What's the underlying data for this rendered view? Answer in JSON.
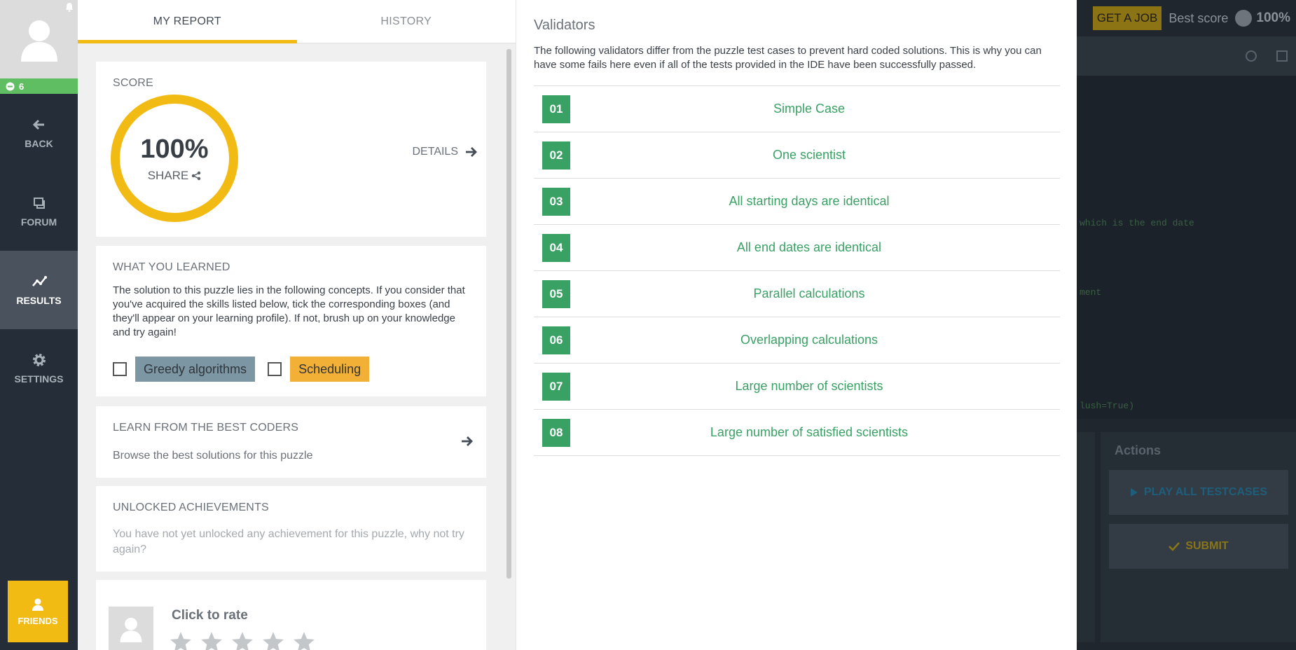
{
  "sidebar": {
    "level": "6",
    "items": [
      {
        "label": "BACK",
        "icon": "arrow-left-icon"
      },
      {
        "label": "FORUM",
        "icon": "forum-icon"
      },
      {
        "label": "RESULTS",
        "icon": "chart-line-icon",
        "active": true
      },
      {
        "label": "SETTINGS",
        "icon": "gear-icon"
      }
    ],
    "friends_label": "FRIENDS"
  },
  "report": {
    "tabs": [
      {
        "label": "MY REPORT",
        "active": true
      },
      {
        "label": "HISTORY",
        "active": false
      }
    ],
    "score": {
      "title": "SCORE",
      "value": "100%",
      "share_label": "SHARE",
      "details_label": "DETAILS"
    },
    "learned": {
      "title": "WHAT YOU LEARNED",
      "text": "The solution to this puzzle lies in the following concepts. If you consider that you've acquired the skills listed below, tick the corresponding boxes (and they'll appear on your learning profile). If not, brush up on your knowledge and try again!",
      "skills": [
        {
          "label": "Greedy algorithms",
          "checked": false,
          "color": "#7d96a3"
        },
        {
          "label": "Scheduling",
          "checked": false,
          "color": "#f3b037"
        }
      ]
    },
    "best_coders": {
      "title": "LEARN FROM THE BEST CODERS",
      "subtitle": "Browse the best solutions for this puzzle"
    },
    "achievements": {
      "title": "UNLOCKED ACHIEVEMENTS",
      "text": "You have not yet unlocked any achievement for this puzzle, why not try again?"
    },
    "rating": {
      "title": "Click to rate",
      "stars": 5,
      "rated": 0
    }
  },
  "validators": {
    "title": "Validators",
    "description": "The following validators differ from the puzzle test cases to prevent hard coded solutions. This is why you can have some fails here even if all of the tests provided in the IDE have been successfully passed.",
    "items": [
      {
        "number": "01",
        "name": "Simple Case"
      },
      {
        "number": "02",
        "name": "One scientist"
      },
      {
        "number": "03",
        "name": "All starting days are identical"
      },
      {
        "number": "04",
        "name": "All end dates are identical"
      },
      {
        "number": "05",
        "name": "Parallel calculations"
      },
      {
        "number": "06",
        "name": "Overlapping calculations"
      },
      {
        "number": "07",
        "name": "Large number of scientists"
      },
      {
        "number": "08",
        "name": "Large number of satisfied scientists"
      }
    ],
    "status_color": "#3aa165"
  },
  "ide": {
    "get_job_label": "GET A JOB",
    "best_score_label": "Best score",
    "best_score_value": "100%",
    "code_fragments": [
      "which is the end date",
      "ment",
      "lush=True)"
    ],
    "actions_title": "Actions",
    "play_all_label": "PLAY ALL TESTCASES",
    "submit_label": "SUBMIT"
  },
  "colors": {
    "accent": "#f2bb13",
    "success": "#3aa165",
    "sidebar_bg": "#252e38"
  }
}
